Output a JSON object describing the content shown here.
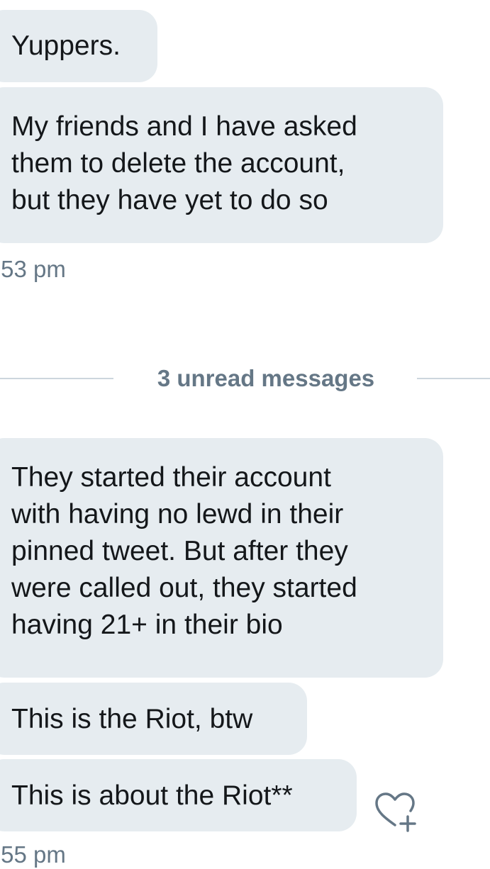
{
  "conversation": {
    "messages_before": [
      {
        "text": "Yuppers."
      },
      {
        "lines": [
          "My friends and I have asked",
          "them to delete the account,",
          "but they have yet to do so"
        ]
      }
    ],
    "timestamp_1": ":53 pm",
    "unread_divider": "3 unread messages",
    "messages_after": [
      {
        "lines": [
          "They started their account",
          "with having no lewd in their",
          "pinned tweet. But after they",
          "were called out, they started",
          "having 21+ in their bio"
        ]
      },
      {
        "text": "This is the Riot, btw"
      },
      {
        "text": "This is about the Riot**"
      }
    ],
    "timestamp_2": ":55 pm"
  },
  "icons": {
    "react": "heart-plus-icon"
  },
  "colors": {
    "bubble_bg": "#e6ecf0",
    "text": "#14171a",
    "muted": "#657786",
    "divider": "#ccd6dd"
  }
}
